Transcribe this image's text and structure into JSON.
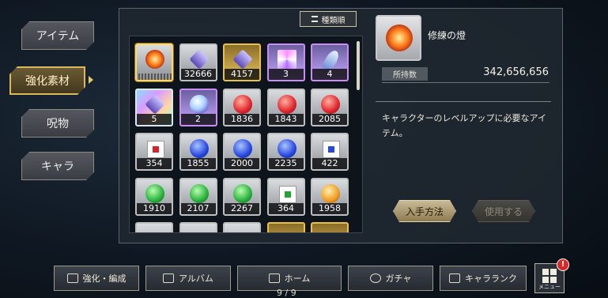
{
  "categories": [
    {
      "label": "アイテム",
      "active": false
    },
    {
      "label": "強化素材",
      "active": true
    },
    {
      "label": "呪物",
      "active": false
    },
    {
      "label": "キャラ",
      "active": false
    }
  ],
  "sort_button": {
    "icon": "sort-icon",
    "label": "種類順"
  },
  "items": [
    {
      "count": "",
      "icon": "sun-gem",
      "style": "normal"
    },
    {
      "count": "32666",
      "icon": "crystal",
      "style": "normal"
    },
    {
      "count": "4157",
      "icon": "crystal",
      "style": "gold"
    },
    {
      "count": "3",
      "icon": "burst",
      "style": "purple"
    },
    {
      "count": "4",
      "icon": "feather",
      "style": "purple"
    },
    {
      "count": "5",
      "icon": "crystal",
      "style": "rainbow"
    },
    {
      "count": "2",
      "icon": "orb",
      "style": "purple"
    },
    {
      "count": "1836",
      "icon": "red-flame",
      "style": "normal"
    },
    {
      "count": "1843",
      "icon": "red-flame",
      "style": "normal"
    },
    {
      "count": "2085",
      "icon": "red-flame",
      "style": "normal"
    },
    {
      "count": "354",
      "icon": "red-box",
      "style": "normal"
    },
    {
      "count": "1855",
      "icon": "blue-flame",
      "style": "normal"
    },
    {
      "count": "2000",
      "icon": "blue-flame",
      "style": "normal"
    },
    {
      "count": "2235",
      "icon": "blue-flame",
      "style": "normal"
    },
    {
      "count": "422",
      "icon": "blue-box",
      "style": "normal"
    },
    {
      "count": "1910",
      "icon": "green-flame",
      "style": "normal"
    },
    {
      "count": "2107",
      "icon": "green-flame",
      "style": "normal"
    },
    {
      "count": "2267",
      "icon": "green-flame",
      "style": "normal"
    },
    {
      "count": "364",
      "icon": "green-box",
      "style": "normal"
    },
    {
      "count": "1958",
      "icon": "orange-flame",
      "style": "normal"
    }
  ],
  "detail": {
    "name": "修練の燈",
    "owned_label": "所持数",
    "owned_value": "342,656,656",
    "description": "キャラクターのレベルアップに必要なアイテム。",
    "obtain_label": "入手方法",
    "use_label": "使用する"
  },
  "bottom_nav": [
    {
      "label": "強化・編成",
      "icon": "team-icon"
    },
    {
      "label": "アルバム",
      "icon": "album-icon"
    },
    {
      "label": "ホーム",
      "icon": "home-icon"
    },
    {
      "label": "ガチャ",
      "icon": "gacha-icon"
    },
    {
      "label": "キャラランク",
      "icon": "rank-icon"
    }
  ],
  "menu": {
    "label": "メニュー",
    "badge": "!"
  },
  "page_indicator": "9 / 9"
}
